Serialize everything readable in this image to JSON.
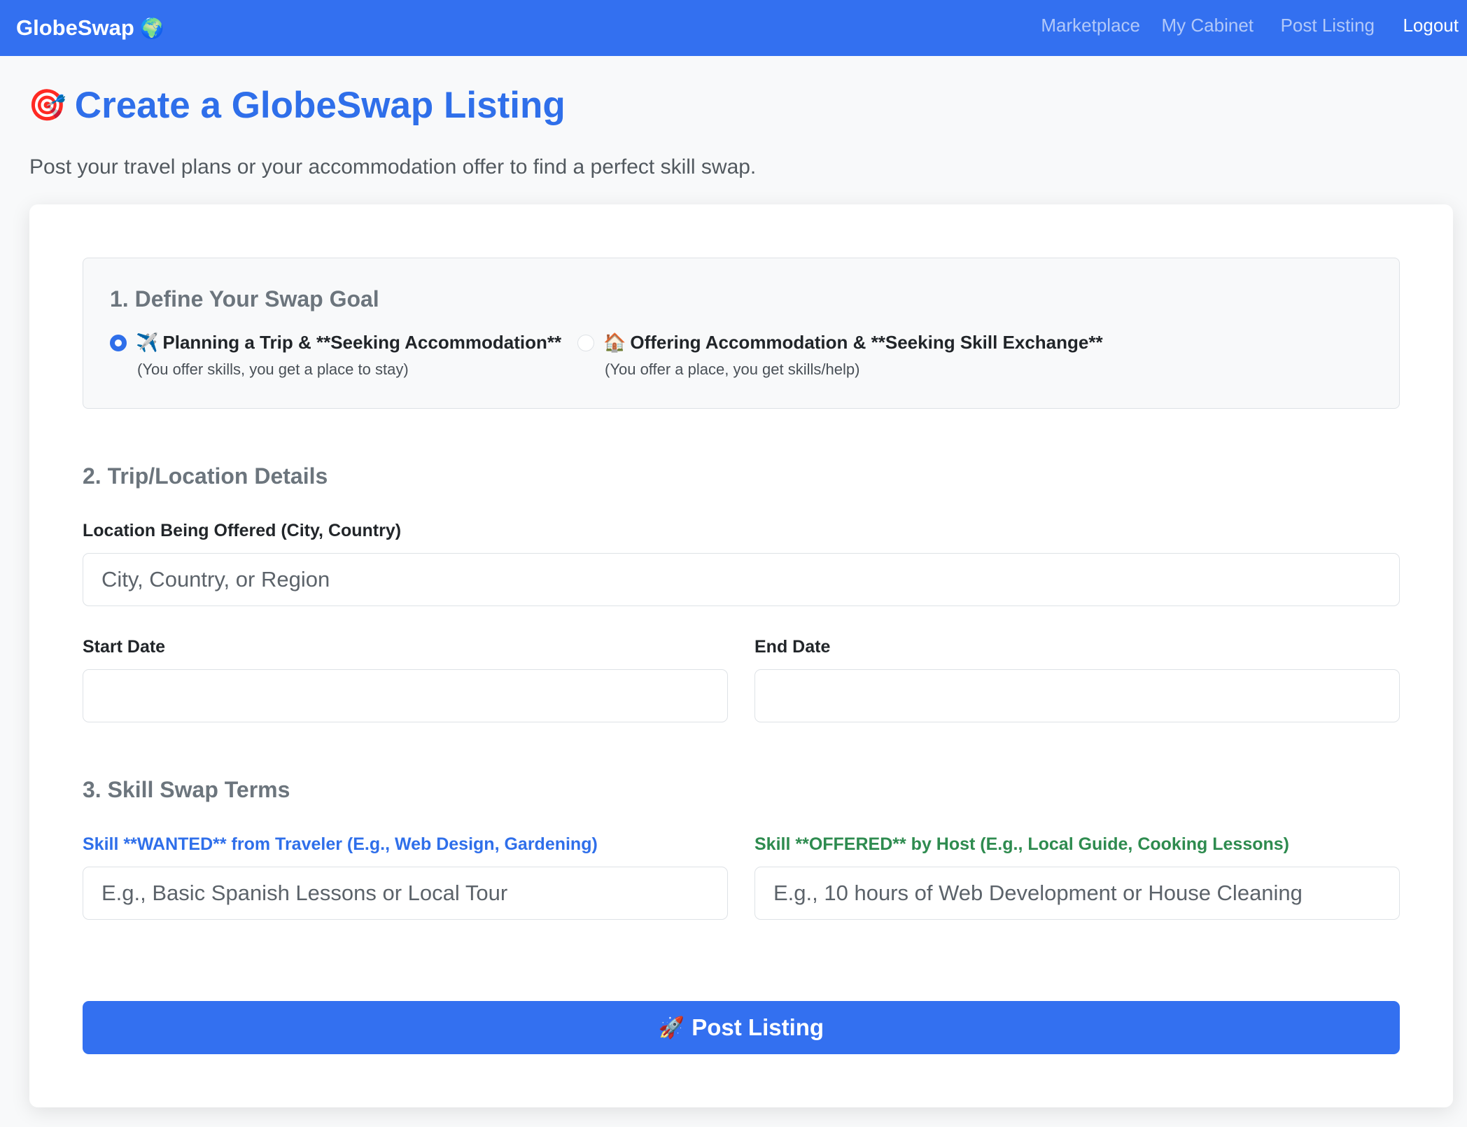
{
  "navbar": {
    "brand": "GlobeSwap",
    "brand_icon": "🌍",
    "links": [
      "Marketplace",
      "My Cabinet",
      "Post Listing",
      "Logout"
    ]
  },
  "header": {
    "title_icon": "🎯",
    "title": "Create a GlobeSwap Listing",
    "subtitle": "Post your travel plans or your accommodation offer to find a perfect skill swap."
  },
  "goal": {
    "heading": "1. Define Your Swap Goal",
    "options": [
      {
        "icon": "✈️",
        "label": "Planning a Trip & **Seeking Accommodation**",
        "help": "(You offer skills, you get a place to stay)",
        "selected": true
      },
      {
        "icon": "🏠",
        "label": "Offering Accommodation & **Seeking Skill Exchange**",
        "help": "(You offer a place, you get skills/help)",
        "selected": false
      }
    ]
  },
  "details": {
    "heading": "2. Trip/Location Details",
    "location_label": "Location Being Offered (City, Country)",
    "location_placeholder": "City, Country, or Region",
    "start_label": "Start Date",
    "end_label": "End Date"
  },
  "terms": {
    "heading": "3. Skill Swap Terms",
    "wanted_label": "Skill **WANTED** from Traveler (E.g., Web Design, Gardening)",
    "wanted_placeholder": "E.g., Basic Spanish Lessons or Local Tour",
    "offered_label": "Skill **OFFERED** by Host (E.g., Local Guide, Cooking Lessons)",
    "offered_placeholder": "E.g., 10 hours of Web Development or House Cleaning"
  },
  "submit": {
    "icon": "🚀",
    "label": "Post Listing"
  },
  "colors": {
    "primary": "#3370f0",
    "title_blue": "#2f6fea",
    "offered_green": "#2e8b4f",
    "muted": "#6c757d"
  }
}
